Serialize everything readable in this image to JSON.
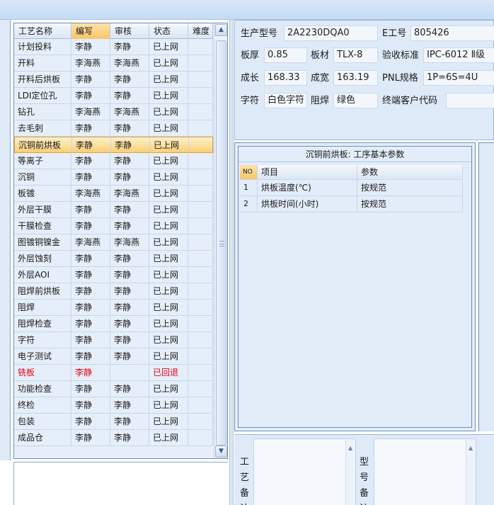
{
  "steps_table": {
    "columns": [
      "工艺名称",
      "编写",
      "审核",
      "状态",
      "难度"
    ],
    "rows": [
      {
        "name": "计划投料",
        "writer": "李静",
        "reviewer": "李静",
        "status": "已上网"
      },
      {
        "name": "开料",
        "writer": "李海燕",
        "reviewer": "李海燕",
        "status": "已上网"
      },
      {
        "name": "开料后烘板",
        "writer": "李静",
        "reviewer": "李静",
        "status": "已上网"
      },
      {
        "name": "LDI定位孔",
        "writer": "李静",
        "reviewer": "李静",
        "status": "已上网"
      },
      {
        "name": "钻孔",
        "writer": "李海燕",
        "reviewer": "李海燕",
        "status": "已上网"
      },
      {
        "name": "去毛刺",
        "writer": "李静",
        "reviewer": "李静",
        "status": "已上网"
      },
      {
        "name": "沉铜前烘板",
        "writer": "李静",
        "reviewer": "李静",
        "status": "已上网"
      },
      {
        "name": "等离子",
        "writer": "李静",
        "reviewer": "李静",
        "status": "已上网"
      },
      {
        "name": "沉铜",
        "writer": "李静",
        "reviewer": "李静",
        "status": "已上网"
      },
      {
        "name": "板镀",
        "writer": "李海燕",
        "reviewer": "李海燕",
        "status": "已上网"
      },
      {
        "name": "外层干膜",
        "writer": "李静",
        "reviewer": "李静",
        "status": "已上网"
      },
      {
        "name": "干膜检查",
        "writer": "李静",
        "reviewer": "李静",
        "status": "已上网"
      },
      {
        "name": "图镀铜镍金",
        "writer": "李海燕",
        "reviewer": "李海燕",
        "status": "已上网"
      },
      {
        "name": "外层蚀刻",
        "writer": "李静",
        "reviewer": "李静",
        "status": "已上网"
      },
      {
        "name": "外层AOI",
        "writer": "李静",
        "reviewer": "李静",
        "status": "已上网"
      },
      {
        "name": "阻焊前烘板",
        "writer": "李静",
        "reviewer": "李静",
        "status": "已上网"
      },
      {
        "name": "阻焊",
        "writer": "李静",
        "reviewer": "李静",
        "status": "已上网"
      },
      {
        "name": "阻焊检查",
        "writer": "李静",
        "reviewer": "李静",
        "status": "已上网"
      },
      {
        "name": "字符",
        "writer": "李静",
        "reviewer": "李静",
        "status": "已上网"
      },
      {
        "name": "电子测试",
        "writer": "李静",
        "reviewer": "李静",
        "status": "已上网"
      },
      {
        "name": "铣板",
        "writer": "李静",
        "reviewer": "",
        "status": "已回退"
      },
      {
        "name": "功能检查",
        "writer": "李静",
        "reviewer": "李静",
        "status": "已上网"
      },
      {
        "name": "终检",
        "writer": "李静",
        "reviewer": "李静",
        "status": "已上网"
      },
      {
        "name": "包装",
        "writer": "李静",
        "reviewer": "李静",
        "status": "已上网"
      },
      {
        "name": "成品仓",
        "writer": "李静",
        "reviewer": "李静",
        "status": "已上网"
      }
    ],
    "selected_index": 6,
    "rejected_index": 20
  },
  "info": {
    "model_label": "生产型号",
    "model": "2A2230DQA0",
    "eng_label": "E工号",
    "eng": "805426",
    "thickness_label": "板厚",
    "thickness": "0.85",
    "material_label": "板材",
    "material": "TLX-8",
    "standard_label": "验收标准",
    "standard": "IPC-6012 Ⅱ级",
    "length_label": "成长",
    "length": "168.33",
    "width_label": "成宽",
    "width": "163.19",
    "pnl_label": "PNL规格",
    "pnl": "1P=6S=4U",
    "legend_label": "字符",
    "legend": "白色字符",
    "mask_label": "阻焊",
    "mask": "绿色",
    "customer_label": "终端客户代码",
    "customer": ""
  },
  "params": {
    "caption": "沉铜前烘板: 工序基本参数",
    "columns": [
      "NO",
      "项目",
      "参数"
    ],
    "rows": [
      {
        "no": "1",
        "item": "烘板温度(℃)",
        "value": "按规范"
      },
      {
        "no": "2",
        "item": "烘板时间(小时)",
        "value": "按规范"
      }
    ]
  },
  "remarks": {
    "process_label": "工艺备注",
    "model_label": "型号备注"
  },
  "colors": {
    "selected_row": "#f9cf78",
    "rejected_text": "#e60012",
    "panel_bg": "#dfeaf8"
  }
}
